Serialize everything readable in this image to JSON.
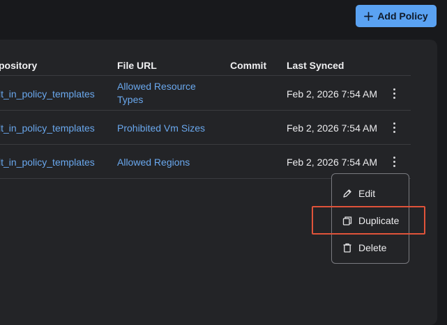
{
  "header": {
    "add_policy_label": "Add Policy"
  },
  "table": {
    "columns": [
      "pository",
      "File URL",
      "Commit",
      "Last Synced"
    ],
    "rows": [
      {
        "repository": "lt_in_policy_templates",
        "file_url_line1": "Allowed Resource",
        "file_url_line2": "Types",
        "commit": "",
        "last_synced": "Feb 2, 2026 7:54 AM"
      },
      {
        "repository": "lt_in_policy_templates",
        "file_url_line1": "Prohibited Vm Sizes",
        "file_url_line2": "",
        "commit": "",
        "last_synced": "Feb 2, 2026 7:54 AM"
      },
      {
        "repository": "lt_in_policy_templates",
        "file_url_line1": "Allowed Regions",
        "file_url_line2": "",
        "commit": "",
        "last_synced": "Feb 2, 2026 7:54 AM"
      }
    ]
  },
  "menu": {
    "items": [
      "Edit",
      "Duplicate",
      "Delete"
    ]
  },
  "icons": {
    "add": "plus-icon",
    "row_actions": "kebab-icon",
    "edit": "pencil-icon",
    "duplicate": "copy-icon",
    "delete": "trash-icon"
  },
  "colors": {
    "accent": "#5aa2f2",
    "link": "#6aa8ee",
    "highlight": "#e0533a"
  }
}
